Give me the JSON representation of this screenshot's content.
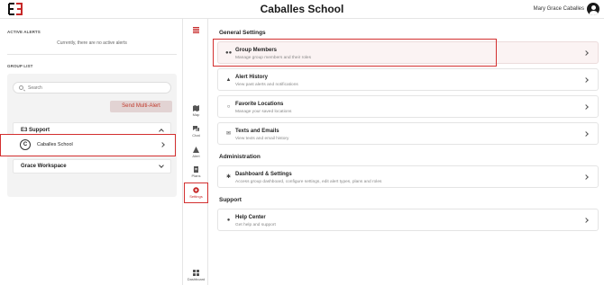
{
  "header": {
    "logo_text": "E3",
    "title": "Caballes School",
    "user_name": "Mary Grace Caballes"
  },
  "left": {
    "active_alerts_label": "ACTIVE ALERTS",
    "no_alerts_text": "Currently, there are no active alerts",
    "group_list_label": "GROUP LIST",
    "search_placeholder": "Search",
    "send_button": "Send Multi-Alert",
    "groups": [
      {
        "name": "E3 Support",
        "expanded": true,
        "members": [
          {
            "initial": "C",
            "name": "Caballes School"
          }
        ]
      },
      {
        "name": "Grace Workspace",
        "expanded": false
      }
    ]
  },
  "rail": {
    "items": [
      {
        "label": "Map",
        "icon": "map-icon"
      },
      {
        "label": "Chat",
        "icon": "chat-icon"
      },
      {
        "label": "Alert",
        "icon": "alert-icon"
      },
      {
        "label": "Plans",
        "icon": "plans-icon"
      },
      {
        "label": "Settings",
        "icon": "settings-icon",
        "active": true
      },
      {
        "label": "Dashboard",
        "icon": "dashboard-icon"
      }
    ]
  },
  "main": {
    "general_title": "General Settings",
    "administration_title": "Administration",
    "support_title": "Support",
    "cards": {
      "group_members": {
        "title": "Group Members",
        "subtitle": "Manage group members and their roles"
      },
      "alert_history": {
        "title": "Alert History",
        "subtitle": "View past alerts and notifications"
      },
      "favorite_locations": {
        "title": "Favorite Locations",
        "subtitle": "Manage your saved locations"
      },
      "texts_emails": {
        "title": "Texts and Emails",
        "subtitle": "View texts and email history"
      },
      "dashboard_settings": {
        "title": "Dashboard & Settings",
        "subtitle": "Access group dashboard, configure settings, edit alert types, plans and roles"
      },
      "help_center": {
        "title": "Help Center",
        "subtitle": "Get help and support"
      }
    }
  },
  "colors": {
    "accent": "#d32f2f",
    "send_button_bg": "#e2d3d3",
    "active_card_bg": "#fbf3f3"
  }
}
